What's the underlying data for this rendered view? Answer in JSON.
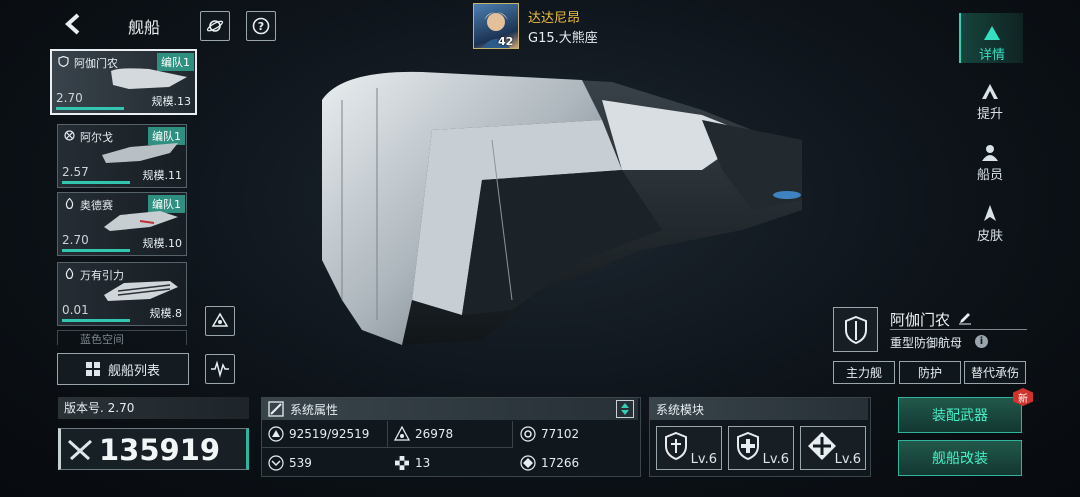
{
  "header": {
    "back_icon": "chevron-left-icon",
    "title": "舰船",
    "planet_icon": "planet-icon",
    "help_icon": "question-icon"
  },
  "commander": {
    "name": "达达尼昂",
    "level": "42",
    "location": "G15.大熊座"
  },
  "ship_list": [
    {
      "name": "阿伽门农",
      "fleet": "编队1",
      "power": "2.70",
      "scale": "规模.13",
      "selected": true
    },
    {
      "name": "阿尔戈",
      "fleet": "编队1",
      "power": "2.57",
      "scale": "规模.11",
      "selected": false
    },
    {
      "name": "奥德赛",
      "fleet": "编队1",
      "power": "2.70",
      "scale": "规模.10",
      "selected": false
    },
    {
      "name": "万有引力",
      "fleet": "",
      "power": "0.01",
      "scale": "规模.8",
      "selected": false
    },
    {
      "name": "蓝色空间",
      "fleet": "",
      "power": "",
      "scale": "",
      "selected": false
    }
  ],
  "fleet_list_button": "舰船列表",
  "version": "版本号. 2.70",
  "combat_power": "135919",
  "attributes": {
    "title": "系统属性",
    "items": [
      {
        "icon": "hull-icon",
        "value": "92519/92519"
      },
      {
        "icon": "armor-icon",
        "value": "26978"
      },
      {
        "icon": "shield-stat-icon",
        "value": "77102"
      },
      {
        "icon": "speed-icon",
        "value": "539"
      },
      {
        "icon": "flag-icon",
        "value": "13"
      },
      {
        "icon": "energy-icon",
        "value": "17266"
      }
    ]
  },
  "modules": {
    "title": "系统模块",
    "items": [
      {
        "icon": "shield-module-icon",
        "level": "Lv.6"
      },
      {
        "icon": "repair-module-icon",
        "level": "Lv.6"
      },
      {
        "icon": "thruster-module-icon",
        "level": "Lv.6"
      }
    ]
  },
  "side_tabs": [
    {
      "label": "详情",
      "icon": "details-icon",
      "active": true
    },
    {
      "label": "提升",
      "icon": "upgrade-icon",
      "active": false
    },
    {
      "label": "船员",
      "icon": "crew-icon",
      "active": false
    },
    {
      "label": "皮肤",
      "icon": "skin-icon",
      "active": false
    }
  ],
  "ship_info": {
    "name": "阿伽门农",
    "type": "重型防御航母",
    "tags": [
      "主力舰",
      "防护",
      "替代承伤"
    ]
  },
  "actions": {
    "equip": "装配武器",
    "refit": "舰船改装",
    "new_badge": "新"
  },
  "colors": {
    "accent": "#2fd2b5",
    "gold": "#f0c040",
    "new_badge": "#d0332b"
  }
}
